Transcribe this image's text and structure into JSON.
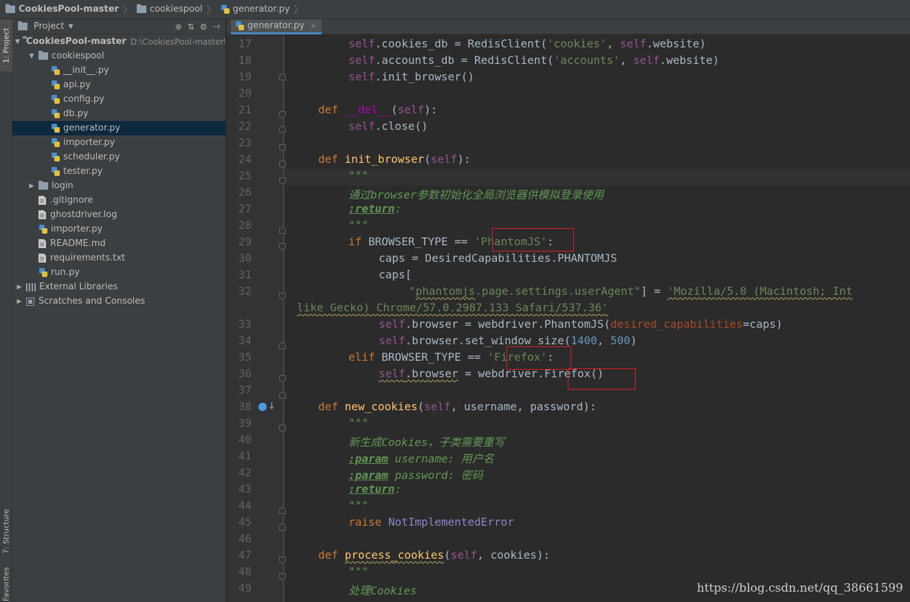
{
  "breadcrumb": {
    "root": "CookiesPool-master",
    "folder": "cookiespool",
    "file": "generator.py"
  },
  "toolstrip": {
    "project_tab": "1: Project",
    "structure_tab": "7: Structure",
    "favorites_tab": "Favorites"
  },
  "project": {
    "title": "Project",
    "root": {
      "label": "CookiesPool-master",
      "path": "D:\\CookiesPool-master\\C"
    },
    "items": [
      {
        "label": "cookiespool",
        "type": "folder",
        "depth": 1,
        "expanded": true
      },
      {
        "label": "__init__.py",
        "type": "py",
        "depth": 2
      },
      {
        "label": "api.py",
        "type": "py",
        "depth": 2
      },
      {
        "label": "config.py",
        "type": "py",
        "depth": 2
      },
      {
        "label": "db.py",
        "type": "py",
        "depth": 2
      },
      {
        "label": "generator.py",
        "type": "py",
        "depth": 2,
        "selected": true
      },
      {
        "label": "importer.py",
        "type": "py",
        "depth": 2
      },
      {
        "label": "scheduler.py",
        "type": "py",
        "depth": 2
      },
      {
        "label": "tester.py",
        "type": "py",
        "depth": 2
      },
      {
        "label": "login",
        "type": "folder",
        "depth": 1,
        "expanded": false
      },
      {
        "label": ".gitignore",
        "type": "file",
        "depth": 1
      },
      {
        "label": "ghostdriver.log",
        "type": "file",
        "depth": 1
      },
      {
        "label": "importer.py",
        "type": "py",
        "depth": 1
      },
      {
        "label": "README.md",
        "type": "file",
        "depth": 1
      },
      {
        "label": "requirements.txt",
        "type": "file",
        "depth": 1
      },
      {
        "label": "run.py",
        "type": "py",
        "depth": 1
      },
      {
        "label": "External Libraries",
        "type": "lib",
        "depth": 0,
        "expanded": false
      },
      {
        "label": "Scratches and Consoles",
        "type": "scratch",
        "depth": 0,
        "expanded": false
      }
    ]
  },
  "tab": {
    "label": "generator.py"
  },
  "editor": {
    "line_numbers": [
      "17",
      "18",
      "19",
      "20",
      "21",
      "22",
      "23",
      "24",
      "25",
      "26",
      "27",
      "28",
      "29",
      "30",
      "31",
      "32",
      "",
      "33",
      "34",
      "35",
      "36",
      "37",
      "38",
      "39",
      "40",
      "41",
      "42",
      "43",
      "44",
      "45",
      "46",
      "47",
      "48",
      "49"
    ]
  },
  "watermark": "https://blog.csdn.net/qq_38661599"
}
